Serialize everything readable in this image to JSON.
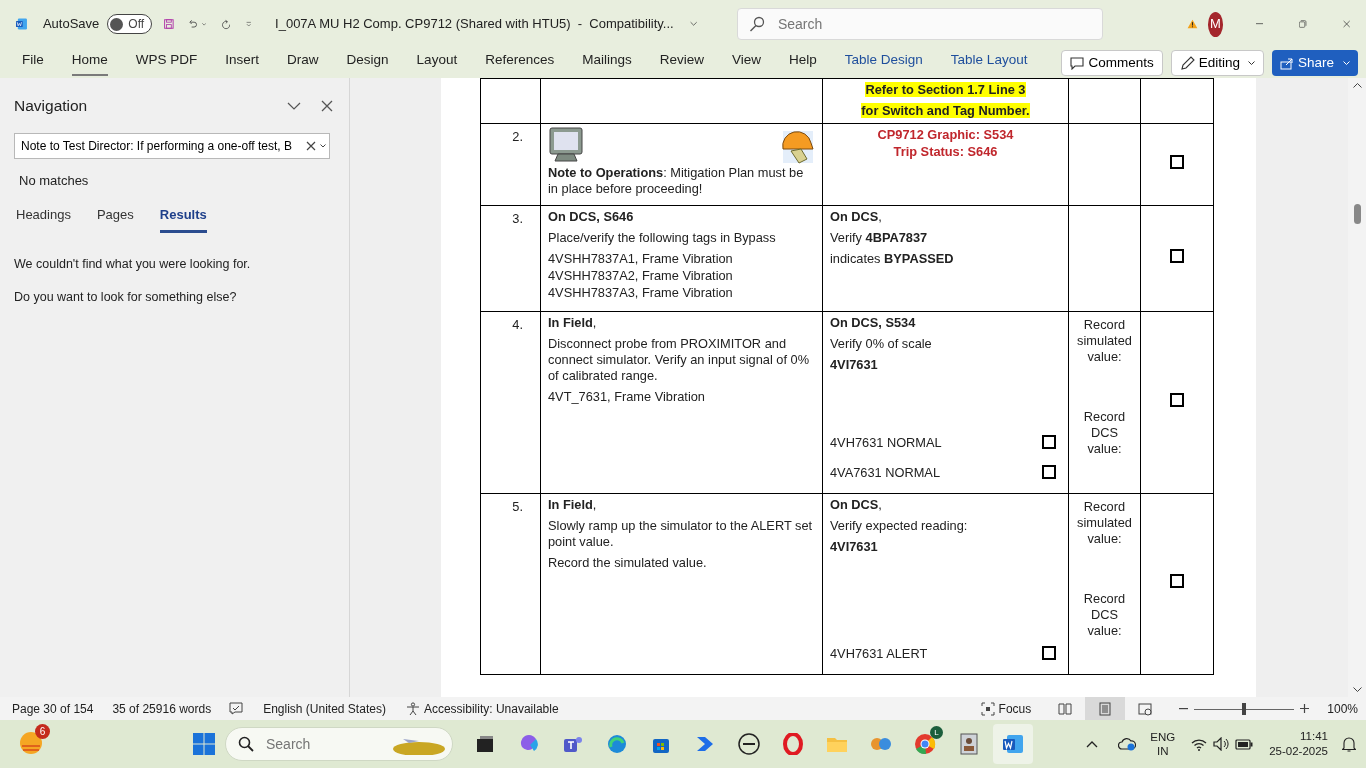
{
  "title_bar": {
    "autosave_label": "AutoSave",
    "autosave": {
      "on": false,
      "label": "Off"
    },
    "document_title": "I_007A MU H2 Comp. CP9712 (Shared with HTU5)  -  Compatibility...",
    "search_placeholder": "Search",
    "avatar": "M"
  },
  "ribbon_tabs": [
    {
      "label": "File",
      "selected": false,
      "kind": "normal"
    },
    {
      "label": "Home",
      "selected": true,
      "kind": "normal"
    },
    {
      "label": "WPS PDF",
      "selected": false,
      "kind": "normal"
    },
    {
      "label": "Insert",
      "selected": false,
      "kind": "normal"
    },
    {
      "label": "Draw",
      "selected": false,
      "kind": "normal"
    },
    {
      "label": "Design",
      "selected": false,
      "kind": "normal"
    },
    {
      "label": "Layout",
      "selected": false,
      "kind": "normal"
    },
    {
      "label": "References",
      "selected": false,
      "kind": "normal"
    },
    {
      "label": "Mailings",
      "selected": false,
      "kind": "normal"
    },
    {
      "label": "Review",
      "selected": false,
      "kind": "normal"
    },
    {
      "label": "View",
      "selected": false,
      "kind": "normal"
    },
    {
      "label": "Help",
      "selected": false,
      "kind": "normal"
    },
    {
      "label": "Table Design",
      "selected": false,
      "kind": "contextual"
    },
    {
      "label": "Table Layout",
      "selected": false,
      "kind": "contextual"
    }
  ],
  "ribbon_buttons": {
    "comments": "Comments",
    "editing": "Editing",
    "share": "Share"
  },
  "navigation": {
    "title": "Navigation",
    "search_value": "Note to Test Director: If performing a one-off test, B",
    "status": "No matches",
    "tabs": [
      {
        "label": "Headings",
        "selected": false
      },
      {
        "label": "Pages",
        "selected": false
      },
      {
        "label": "Results",
        "selected": true
      }
    ],
    "messages": [
      "We couldn't find what you were looking for.",
      "Do you want to look for something else?"
    ]
  },
  "table_rows": [
    {
      "number": "",
      "left": [],
      "right": [
        {
          "kind": "highlight",
          "text": "Refer to Section 1.7 Line 3"
        },
        {
          "kind": "highlight",
          "text": "for Switch and Tag Number."
        }
      ],
      "checks": [],
      "notes": []
    },
    {
      "number": "2.",
      "icons": true,
      "left": [
        {
          "kind": "normal",
          "text": "**Note to Operations**: Mitigation Plan must be in place before proceeding!"
        }
      ],
      "right": [
        {
          "kind": "red",
          "text": "CP9712 Graphic: S534"
        },
        {
          "kind": "red",
          "text": "Trip Status: S646"
        }
      ],
      "checks": [],
      "notes": [],
      "checked": false
    },
    {
      "number": "3.",
      "left": [
        {
          "kind": "bold",
          "text": "On DCS, S646"
        },
        {
          "kind": "normal",
          "text": "Place/verify the following tags in Bypass"
        },
        {
          "kind": "tight",
          "text": "4VSHH7837A1, Frame Vibration"
        },
        {
          "kind": "tight",
          "text": "4VSHH7837A2, Frame Vibration"
        },
        {
          "kind": "tight",
          "text": "4VSHH7837A3, Frame Vibration"
        }
      ],
      "right": [
        {
          "kind": "normal",
          "text": "**On DCS**,"
        },
        {
          "kind": "normal",
          "text": "Verify **4BPA7837**"
        },
        {
          "kind": "normal",
          "text": " indicates **BYPASSED**"
        }
      ],
      "checks": [],
      "notes": [],
      "checked": false
    },
    {
      "number": "4.",
      "left": [
        {
          "kind": "normal",
          "text": "**In Field**,"
        },
        {
          "kind": "normal",
          "text": "Disconnect probe from PROXIMITOR and connect simulator. Verify an input signal of 0% of calibrated range."
        },
        {
          "kind": "normal",
          "text": "4VT_7631, Frame Vibration"
        }
      ],
      "right": [
        {
          "kind": "bold",
          "text": "On DCS, S534"
        },
        {
          "kind": "normal",
          "text": "Verify 0% of scale"
        },
        {
          "kind": "bold",
          "text": "4VI7631"
        }
      ],
      "checks": [
        {
          "text": "4VH7631 NORMAL",
          "checked": false
        },
        {
          "text": "4VA7631 NORMAL",
          "checked": false
        }
      ],
      "notes": [
        "Record simulated value:",
        "Record DCS value:"
      ],
      "checked": false
    },
    {
      "number": "5.",
      "left": [
        {
          "kind": "normal",
          "text": "**In Field**,"
        },
        {
          "kind": "normal",
          "text": "Slowly ramp up the simulator to the ALERT set point value."
        },
        {
          "kind": "normal",
          "text": "Record the simulated value."
        }
      ],
      "right": [
        {
          "kind": "normal",
          "text": "**On DCS**,"
        },
        {
          "kind": "normal",
          "text": "Verify expected reading:"
        },
        {
          "kind": "bold",
          "text": "4VI7631"
        }
      ],
      "checks": [
        {
          "text": "4VH7631 ALERT",
          "checked": false
        }
      ],
      "notes": [
        "Record simulated value:",
        "Record DCS value:"
      ],
      "checked": false
    }
  ],
  "status_bar": {
    "page": "Page 30 of 154",
    "words": "35 of 25916 words",
    "language": "English (United States)",
    "accessibility": "Accessibility: Unavailable",
    "focus": "Focus",
    "views": [
      {
        "selected": false
      },
      {
        "selected": true
      },
      {
        "selected": false
      }
    ],
    "zoom": {
      "level": 0.5,
      "label": "100%"
    }
  },
  "taskbar": {
    "widget_badge": "6",
    "search_placeholder": "Search",
    "chrome_badge": "L",
    "language": "ENG",
    "region": "IN",
    "time": "11:41",
    "date": "25-02-2025"
  }
}
